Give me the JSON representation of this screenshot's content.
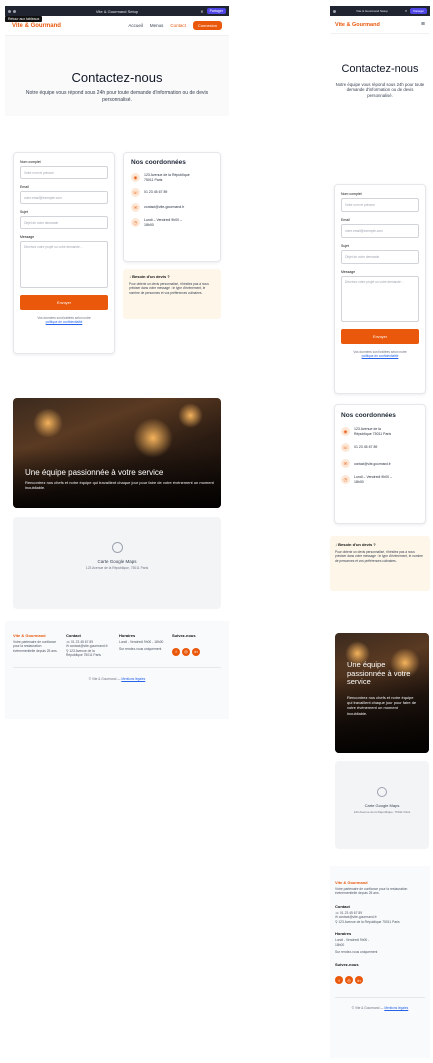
{
  "browser": {
    "title": "Vite & Gourmand Setup",
    "share": "Partager",
    "tooltip": "Retour aux tableaux"
  },
  "nav": {
    "logo": "Vite & Gourmand",
    "links": [
      "Accueil",
      "Menus",
      "Contact"
    ],
    "login": "Connexion",
    "menu_icon": "≡"
  },
  "hero": {
    "title": "Contactez-nous",
    "subtitle": "Notre équipe vous répond sous 24h pour toute demande d'information ou de devis personnalisé."
  },
  "form": {
    "name_label": "Nom complet",
    "name_placeholder": "Votre nom et prénom",
    "email_label": "Email",
    "email_placeholder": "votre.email@exemple.com",
    "subject_label": "Sujet",
    "subject_placeholder": "Objet de votre demande",
    "message_label": "Message",
    "message_placeholder": "Décrivez votre projet ou votre demande...",
    "submit": "Envoyer",
    "privacy_text": "Vos données sont traitées selon notre",
    "privacy_link": "politique de confidentialité"
  },
  "coords": {
    "title": "Nos coordonnées",
    "address": "123 Avenue de la République 75011 Paris",
    "phone": "01 23 45 67 89",
    "email": "contact@vite-gourmand.fr",
    "hours": "Lundi – Vendredi 9h00 – 18h00"
  },
  "quote": {
    "title": "Besoin d'un devis ?",
    "body": "Pour obtenir un devis personnalisé, n'hésitez pas à nous préciser dans votre message : le type d'événement, le nombre de personnes et vos préférences culinaires."
  },
  "team": {
    "title": "Une équipe passionnée à votre service",
    "subtitle": "Rencontrez nos chefs et notre équipe qui travaillent chaque jour pour faire de votre événement un moment inoubliable."
  },
  "map": {
    "title": "Carte Google Maps",
    "address": "123 Avenue de la République, 75011 Paris"
  },
  "footer": {
    "brand": "Vite & Gourmand",
    "about": "Votre partenaire de confiance pour la restauration événementielle depuis 25 ans.",
    "contact_title": "Contact",
    "phone": "01 23 45 67 89",
    "email": "contact@vite-gourmand.fr",
    "address": "123 Avenue de la République 75011 Paris",
    "hours_title": "Horaires",
    "hours": "Lundi - Vendredi 9h00 - 18h00",
    "appointment": "Sur rendez-vous uniquement",
    "social_title": "Suivez-nous",
    "copyright": "© Vite & Gourmand —",
    "legal": "Mentions légales"
  },
  "colors": {
    "accent": "#ea580c",
    "link": "#2563eb",
    "quote_bg": "#fdf6e9"
  }
}
